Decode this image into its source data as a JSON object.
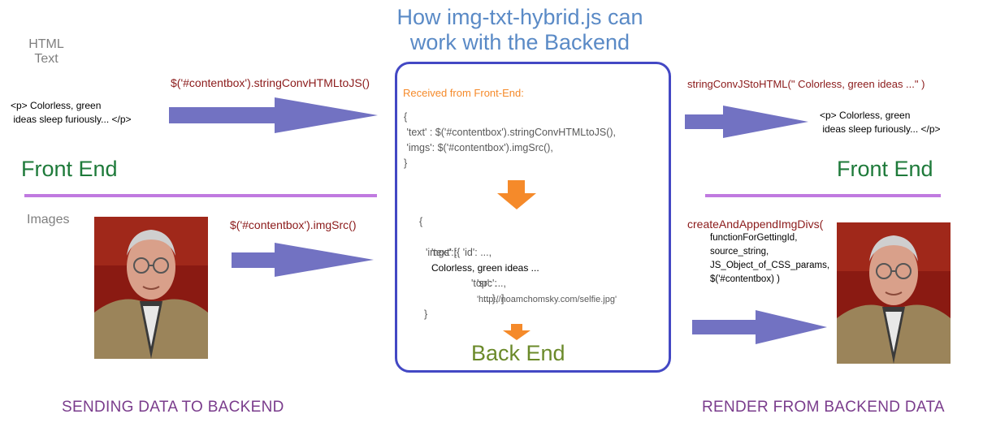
{
  "title_line1": "How img-txt-hybrid.js can",
  "title_line2": "work with the Backend",
  "html_text_line1": "HTML",
  "html_text_line2": "Text",
  "images_label": "Images",
  "left_call_text": "$('#contentbox').stringConvHTMLtoJS()",
  "left_call_imgs": "$('#contentbox').imgSrc()",
  "left_html_snippet": "<p> Colorless, green\n ideas sleep furiously... </p>",
  "front_end_left": "Front End",
  "front_end_right": "Front End",
  "received_label": "Received from Front-End:",
  "received_code": "{\n 'text' : $('#contentbox').stringConvHTMLtoJS(),\n 'imgs': $('#contentbox').imgSrc(),\n}",
  "backend_open": "{",
  "backend_text_key": "'text' :",
  "backend_text_val": "Colorless, green ideas ...",
  "backend_imgs_line": "'imgs':[{ 'id': ...,",
  "backend_src_key": "'src':",
  "backend_src_val": "'http://noamchomsky.com/selfie.jpg'",
  "backend_top_line": "'top': ...,",
  "backend_end_line": "... }, ]",
  "backend_close": "}",
  "back_end_label": "Back End",
  "right_call_text": "stringConvJStoHTML(\" Colorless, green ideas ...\" )",
  "right_html_snippet": "<p> Colorless, green\n ideas sleep furiously... </p>",
  "right_call_imgs_name": "createAndAppendImgDivs(",
  "right_call_imgs_args": "functionForGettingId,\nsource_string,\nJS_Object_of_CSS_params,\n$('#contentbox) )",
  "footer_left": "SENDING DATA TO BACKEND",
  "footer_right": "RENDER FROM BACKEND DATA",
  "colors": {
    "arrow": "#7272c2",
    "orange_arrow": "#f58a2a",
    "box_border": "#4348c4",
    "divider": "#c07ae0",
    "green": "#1e7a3a",
    "purple": "#7a3c8c",
    "title": "#5a8ac6",
    "received": "#f58a2a",
    "back_end": "#6b8a2a"
  }
}
